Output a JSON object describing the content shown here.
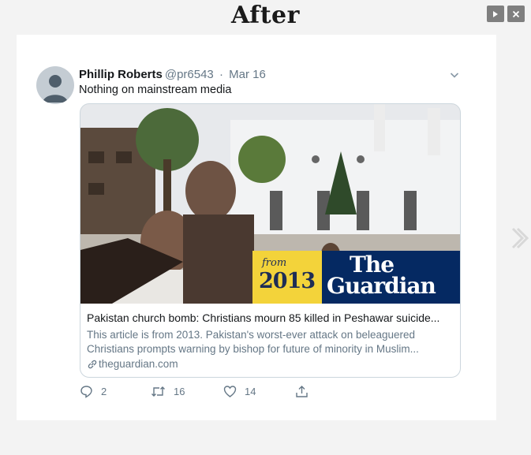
{
  "heading": "After",
  "controls": {
    "play_icon": "play-icon",
    "close_icon": "close-icon"
  },
  "tweet": {
    "author_name": "Phillip Roberts",
    "author_handle": "@pr6543",
    "separator": "·",
    "date": "Mar 16",
    "text": "Nothing on mainstream media"
  },
  "link_card": {
    "badge_from": "from",
    "badge_year": "2013",
    "badge_brand_the": "The",
    "badge_brand_name": "Guardian",
    "title": "Pakistan church bomb: Christians mourn 85 killed in Peshawar suicide...",
    "description": "This article is from 2013. Pakistan's worst-ever attack on beleaguered Christians prompts warning by bishop for future of minority in Muslim...",
    "domain": "theguardian.com"
  },
  "actions": {
    "reply_count": "2",
    "retweet_count": "16",
    "like_count": "14"
  },
  "colors": {
    "badge_yellow": "#f3d33a",
    "badge_navy": "#052962",
    "muted_text": "#657786",
    "border": "#ccd6dd"
  }
}
